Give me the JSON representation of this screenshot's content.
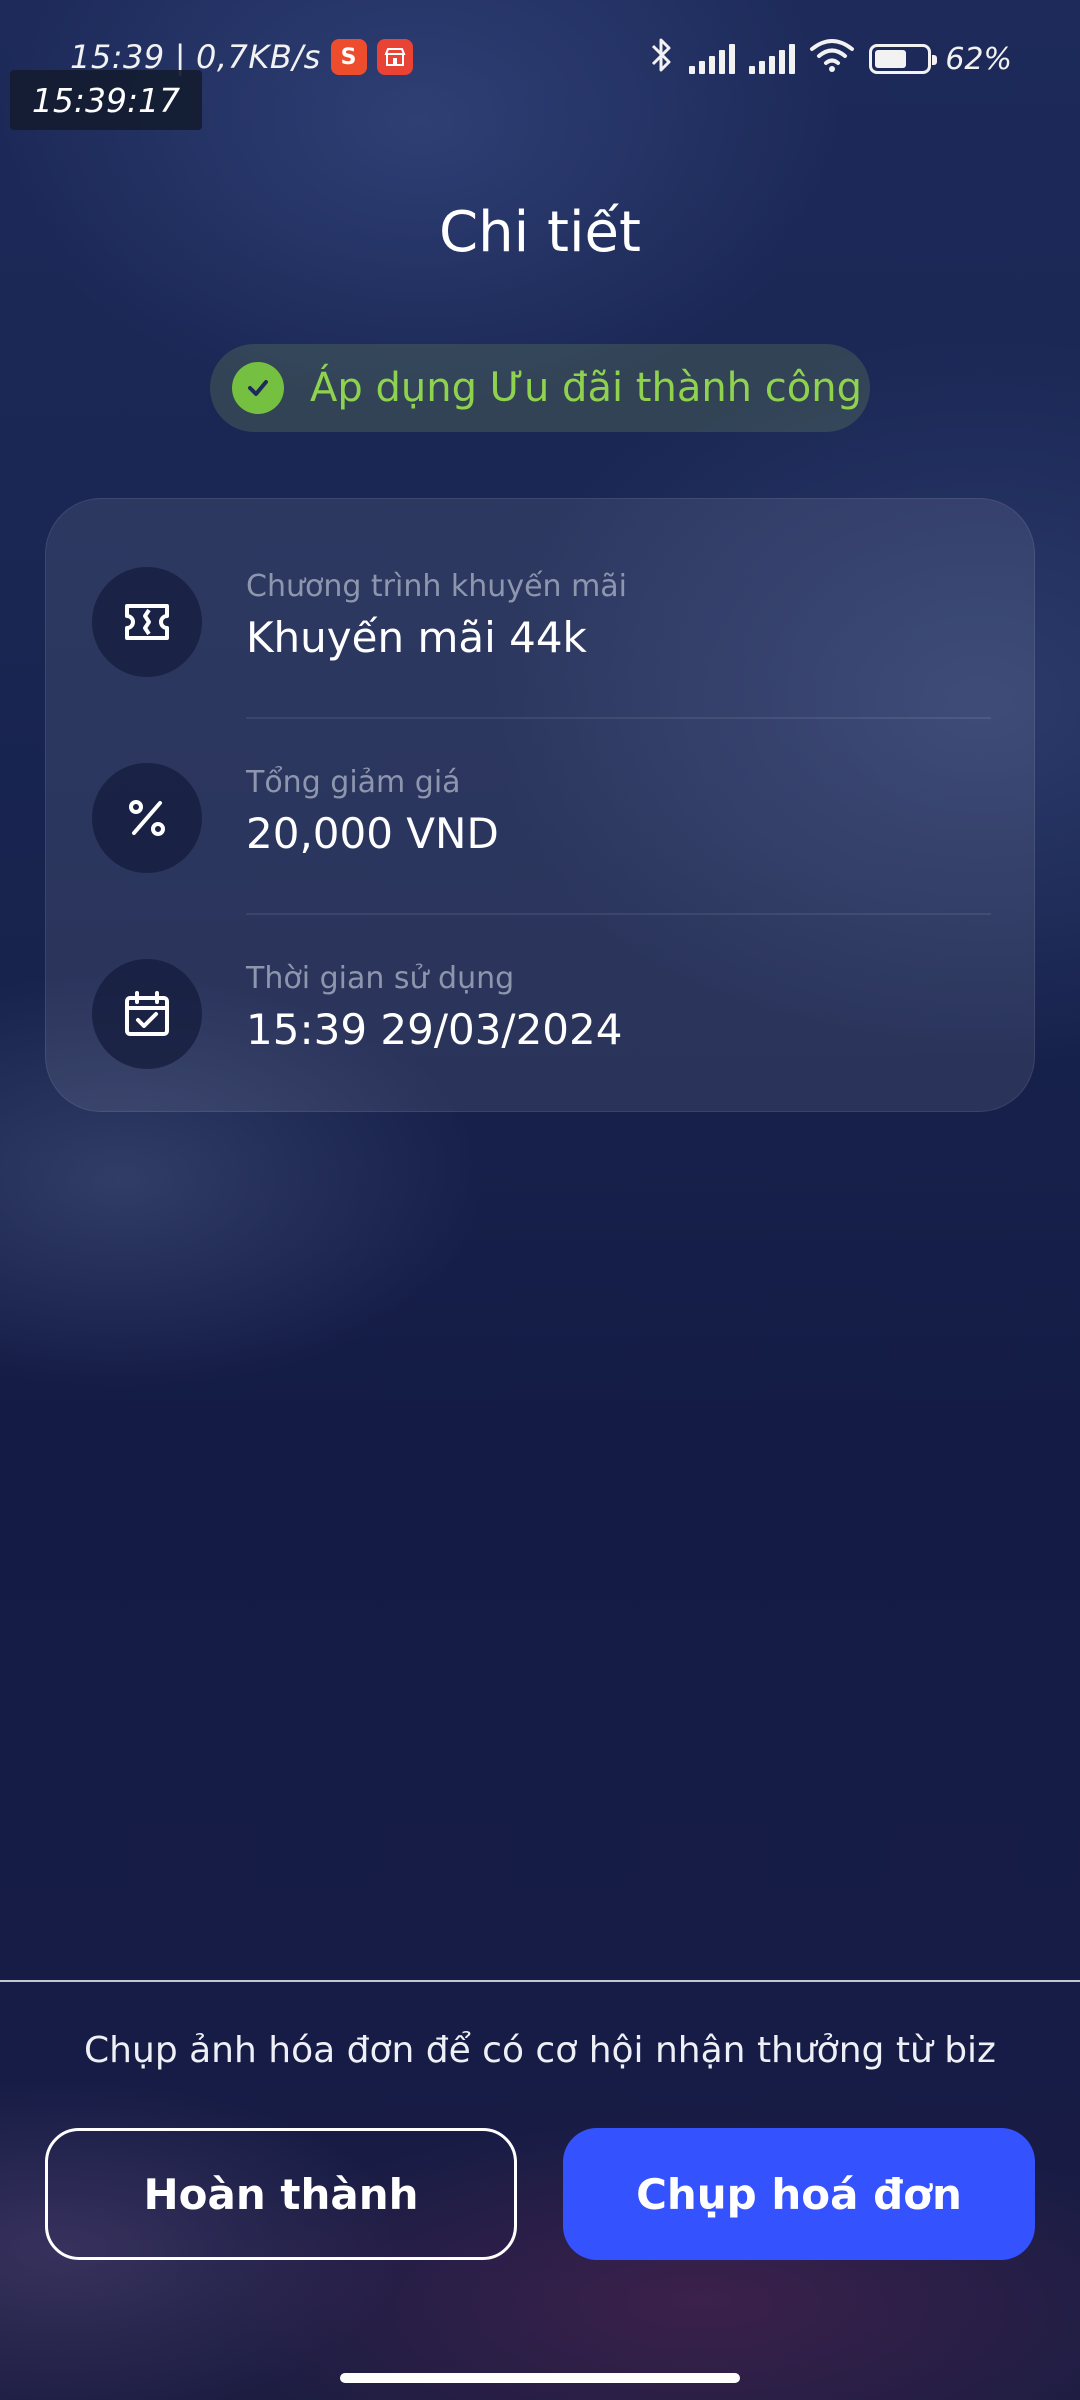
{
  "status_bar": {
    "time": "15:39",
    "separator": "|",
    "net_speed": "0,7KB/s",
    "overlay_clock": "15:39:17",
    "battery_percent": "62%",
    "battery_level": 0.62,
    "notification_icons": [
      "shopee-icon",
      "app-store-icon"
    ],
    "status_icons": [
      "bluetooth-icon",
      "signal-icon",
      "signal-icon",
      "wifi-icon",
      "battery-icon"
    ]
  },
  "page": {
    "title": "Chi tiết"
  },
  "success": {
    "message": "Áp dụng Ưu đãi thành công",
    "color": "#8ed24e"
  },
  "details": {
    "items": [
      {
        "icon": "ticket-icon",
        "label": "Chương trình khuyến mãi",
        "value": "Khuyến mãi 44k"
      },
      {
        "icon": "percent-icon",
        "label": "Tổng giảm giá",
        "value": "20,000 VND"
      },
      {
        "icon": "calendar-check-icon",
        "label": "Thời gian sử dụng",
        "value": "15:39 29/03/2024"
      }
    ]
  },
  "footer": {
    "hint": "Chụp ảnh hóa đơn để có cơ hội nhận thưởng từ biz",
    "done_label": "Hoàn thành",
    "capture_label": "Chụp hoá đơn",
    "accent_color": "#3552ff"
  }
}
